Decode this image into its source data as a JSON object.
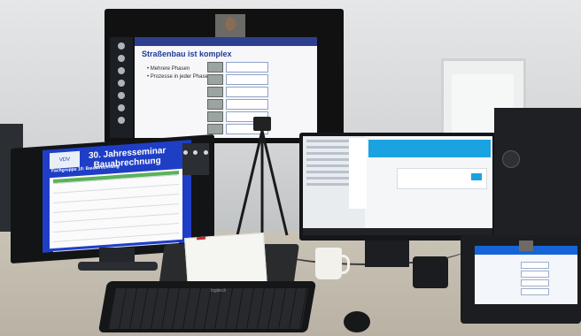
{
  "scene": {
    "wall_slide": {
      "title": "Straßenbau ist komplex",
      "bullets": [
        "Mehrere Phasen",
        "Prozesse in jeder Phase"
      ]
    },
    "left_monitor": {
      "logo": "VDV",
      "title_line1": "30. Jahresseminar",
      "title_line2": "Bauabrechnung",
      "subtitle": "Fachgruppe 10: Bauabrechnung"
    },
    "keyboard_brand": "logitech",
    "colors": {
      "slide_blue": "#1f3a93",
      "left_screen_blue": "#1f3ec6",
      "accent_cyan": "#1aa3e0",
      "laptop_blue": "#1565d8"
    }
  }
}
